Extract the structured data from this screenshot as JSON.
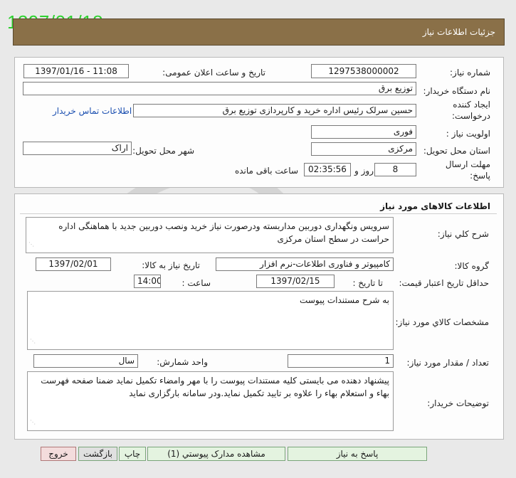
{
  "stamp_date": "1397/01/18",
  "header": {
    "title": "جزئیات اطلاعات نیاز"
  },
  "info": {
    "need_number_label": "شماره نیاز:",
    "need_number": "1297538000002",
    "announce_label": "تاریخ و ساعت اعلان عمومی:",
    "announce_value": "1397/01/16 - 11:08",
    "buyer_label": "نام دستگاه خریدار:",
    "buyer_value": "توزیع برق",
    "creator_label_1": "ایجاد کننده",
    "creator_label_2": "درخواست:",
    "creator_value": "حسین سرلک رئیس اداره خرید و کارپردازی توزیع برق",
    "contact_link": "اطلاعات تماس خریدار",
    "priority_label": "اولویت نیاز :",
    "priority_value": "فوری",
    "province_label": "استان محل تحویل:",
    "province_value": "مرکزی",
    "city_label": "شهر محل تحویل:",
    "city_value": "اراک",
    "deadline_label_1": "مهلت ارسال",
    "deadline_label_2": "پاسخ:",
    "days_value": "8",
    "days_label": "روز و",
    "time_value": "02:35:56",
    "remaining_label": "ساعت باقی مانده"
  },
  "goods": {
    "section_title": "اطلاعات کالاهای مورد نیاز",
    "summary_label": "شرح کلي نياز:",
    "summary_value": "سرویس ونگهداری دوربین مداربسته ودرصورت نیاز خرید ونصب دوربین جدید با هماهنگی اداره حراست در سطح استان مرکزی",
    "group_label": "گروه کالا:",
    "group_value": "کامپیوتر و فناوری اطلاعات-نرم افزار",
    "need_date_label": "تاریخ نیاز به کالا:",
    "need_date_value": "1397/02/01",
    "validity_label": "حداقل تاریخ اعتبار قیمت:",
    "until_label": "تا تاریخ :",
    "validity_date": "1397/02/15",
    "hour_label": "ساعت :",
    "validity_time": "14:00",
    "specs_label": "مشخصات کالاي مورد نياز:",
    "specs_value": "به شرح مستندات پیوست",
    "qty_label": "تعداد / مقدار مورد نیاز:",
    "qty_value": "1",
    "unit_label": "واحد شمارش:",
    "unit_value": "سال",
    "notes_label": "توضیحات خریدار:",
    "notes_value": "پیشنهاد دهنده می بایستی کلیه مستندات پیوست را با مهر وامضاء تکمیل نماید ضمنا صفحه فهرست بهاء و استعلام بهاء را علاوه بر تایید تکمیل نماید.ودر سامانه بارگزاری نماید"
  },
  "buttons": {
    "reply": "پاسخ به نیاز",
    "attachments": "مشاهده مدارک پیوستي (1)",
    "print": "چاپ",
    "back": "بازگشت",
    "exit": "خروج"
  },
  "colors": {
    "header_bg": "#8a7048",
    "stamp": "#2fd12f",
    "link": "#1b4fb0"
  }
}
